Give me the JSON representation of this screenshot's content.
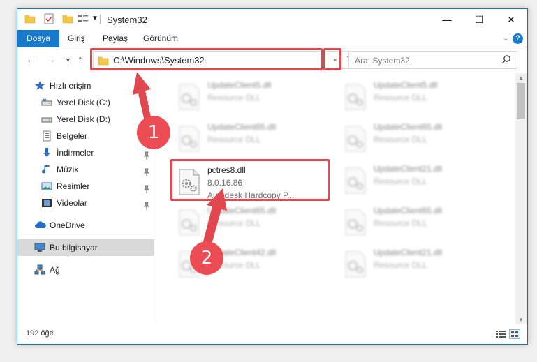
{
  "window": {
    "title": "System32",
    "minimize": "—",
    "maximize": "☐",
    "close": "✕"
  },
  "ribbon": {
    "tabs": [
      "Dosya",
      "Giriş",
      "Paylaş",
      "Görünüm"
    ],
    "help": "?"
  },
  "address": {
    "path": "C:\\Windows\\System32",
    "search_placeholder": "Ara: System32"
  },
  "sidebar": {
    "items": [
      {
        "label": "Hızlı erişim",
        "icon": "star-icon"
      },
      {
        "label": "Yerel Disk (C:)",
        "icon": "drive-icon",
        "pinned": true
      },
      {
        "label": "Yerel Disk (D:)",
        "icon": "drive-icon",
        "pinned": true
      },
      {
        "label": "Belgeler",
        "icon": "documents-icon",
        "pinned": true
      },
      {
        "label": "İndirmeler",
        "icon": "download-icon",
        "pinned": true
      },
      {
        "label": "Müzik",
        "icon": "music-icon",
        "pinned": true
      },
      {
        "label": "Resimler",
        "icon": "pictures-icon",
        "pinned": true
      },
      {
        "label": "Videolar",
        "icon": "videos-icon",
        "pinned": true
      },
      {
        "label": "OneDrive",
        "icon": "onedrive-icon"
      },
      {
        "label": "Bu bilgisayar",
        "icon": "computer-icon",
        "selected": true
      },
      {
        "label": "Ağ",
        "icon": "network-icon"
      }
    ]
  },
  "files": {
    "highlighted": {
      "name": "pctres8.dll",
      "version": "8.0.16.86",
      "description": "Autodesk Hardcopy P..."
    },
    "background": [
      {
        "name": "UpdateClient5.dll",
        "type": "Resource DLL"
      },
      {
        "name": "UpdateClient5.dll",
        "type": "Resource DLL"
      },
      {
        "name": "UpdateClient65.dll",
        "type": "Resource DLL"
      },
      {
        "name": "UpdateClient65.dll",
        "type": "Resource DLL"
      },
      {
        "name": "UpdateClient21.dll",
        "type": "Resource DLL"
      },
      {
        "name": "UpdateClient65.dll",
        "type": "Resource DLL"
      },
      {
        "name": "UpdateClient65.dll",
        "type": "Resource DLL"
      },
      {
        "name": "UpdateClient42.dll",
        "type": "Resource DLL"
      },
      {
        "name": "UpdateClient21.dll",
        "type": "Resource DLL"
      }
    ]
  },
  "status": {
    "count": "192 öğe"
  },
  "annotations": {
    "step1": "1",
    "step2": "2",
    "color": "#e0474f"
  }
}
